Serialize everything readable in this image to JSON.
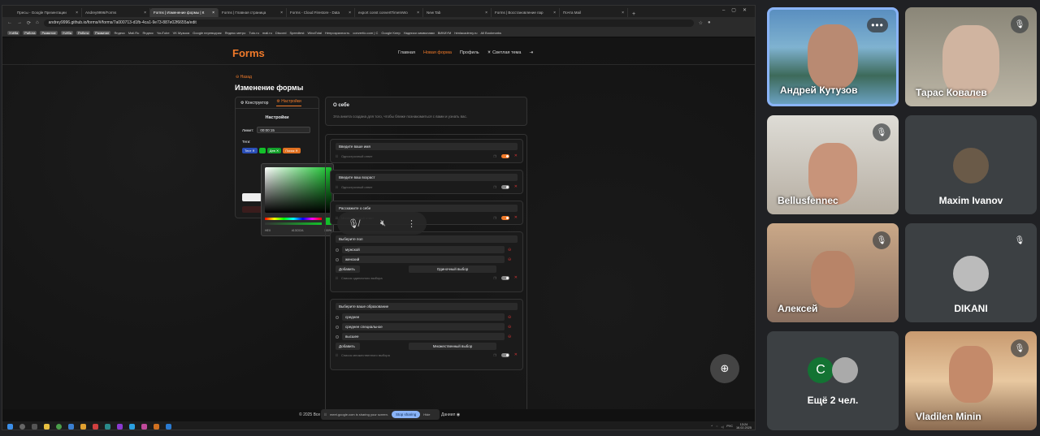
{
  "browser": {
    "tabs": [
      {
        "label": "Пресы - Google Презентации"
      },
      {
        "label": "Andrey9996/Forms"
      },
      {
        "label": "Forms | Изменение формы | К"
      },
      {
        "label": "Forms | Главная страница"
      },
      {
        "label": "Forms - Cloud Firestore - Data"
      },
      {
        "label": "export const convertTimeInWo"
      },
      {
        "label": "New Tab"
      },
      {
        "label": "Forms | Восстановление пар"
      },
      {
        "label": "Почта Mail"
      }
    ],
    "active_tab": 2,
    "url": "andrey9996.github.io/forms/#/forms/7a000713-d1fb-4ca1-9e73-887e02f6655a/edit",
    "bookmarks": [
      "Учёба",
      "Работа",
      "Развитие",
      "Учёба",
      "Работа",
      "Развитие",
      "Яндекс",
      "Mail.Ru",
      "Яндекс",
      "YouTube",
      "VK Музыка",
      "Google переводчик",
      "Яндекс метро",
      "Tuto.ru",
      "mail.ru",
      "Discord",
      "Speedtest",
      "WinaTotal",
      "Непрозрачность",
      "convertio.com | C",
      "Google Keep",
      "Надписи символами",
      "ВИКИУМ",
      "htmlacademy.ru",
      "All Bookmarks"
    ],
    "bookmark_chips": [
      0,
      1,
      2,
      3,
      4,
      5
    ]
  },
  "site": {
    "logo": "Forms",
    "nav": {
      "home": "Главная",
      "new_form": "Новая форма",
      "profile": "Профиль",
      "theme": "Светлая тема"
    },
    "back": "Назад",
    "page_title": "Изменение формы",
    "tabs": {
      "constructor": "Конструктор",
      "settings": "Настройки"
    },
    "settings_title": "Настройки",
    "limit_label": "Лимит:",
    "limit_value": "00:00:15",
    "tags_label": "Теги:",
    "tags": [
      {
        "text": "Тест",
        "color": "#2b4fb8"
      },
      {
        "text": "",
        "color": "#13c02a"
      },
      {
        "text": "Дев",
        "color": "#13a02a"
      },
      {
        "text": "Поиск",
        "color": "#e07020"
      }
    ],
    "picker": {
      "mode": "HEX",
      "hex": "#13C02A",
      "alpha": "100%",
      "color": "#13c02a"
    },
    "form_title": "О себе",
    "form_desc": "Эта анкета создана для того, чтобы ближе познакомиться с вами и узнать вас.",
    "questions": [
      {
        "title": "Введите ваше имя",
        "type": "Однострочный ответ",
        "required": true
      },
      {
        "title": "Введите ваш возраст",
        "type": "Однострочный ответ",
        "required": false
      },
      {
        "title": "Расскажите о себе",
        "type": "Многострочный ответ",
        "required": true
      },
      {
        "title": "Выберите пол",
        "options": [
          "мужской",
          "женский"
        ],
        "add": "Добавить",
        "select": "Одиночный выбор",
        "type": "Список одиночного выбора",
        "required": false
      },
      {
        "title": "Выберите ваше образование",
        "options": [
          "среднее",
          "среднее специальное",
          "высшее"
        ],
        "add": "Добавить",
        "select": "Множественный выбор",
        "type": "Список множественного выбора",
        "required": false
      }
    ],
    "footer_copy": "© 2025 Все",
    "footer_author": "Даниил"
  },
  "meet": {
    "share_notice": "meet.google.com is sharing your screen.",
    "stop_sharing": "Stop sharing",
    "hide": "Hide",
    "participants": [
      {
        "name": "Андрей Кутузов",
        "muted": false,
        "speaking": true
      },
      {
        "name": "Тарас Ковалев",
        "muted": true
      },
      {
        "name": "Bellusfennec",
        "muted": true
      },
      {
        "name": "Maxim Ivanov",
        "muted": false
      },
      {
        "name": "Алексей",
        "muted": true
      },
      {
        "name": "DIKANI",
        "muted": true
      },
      {
        "name": "Ещё 2 чел.",
        "initial": "C"
      },
      {
        "name": "Vladilen Minin",
        "muted": true
      }
    ]
  },
  "taskbar": {
    "lang": "РУС",
    "time": "13:24",
    "date": "16.02.2025"
  }
}
